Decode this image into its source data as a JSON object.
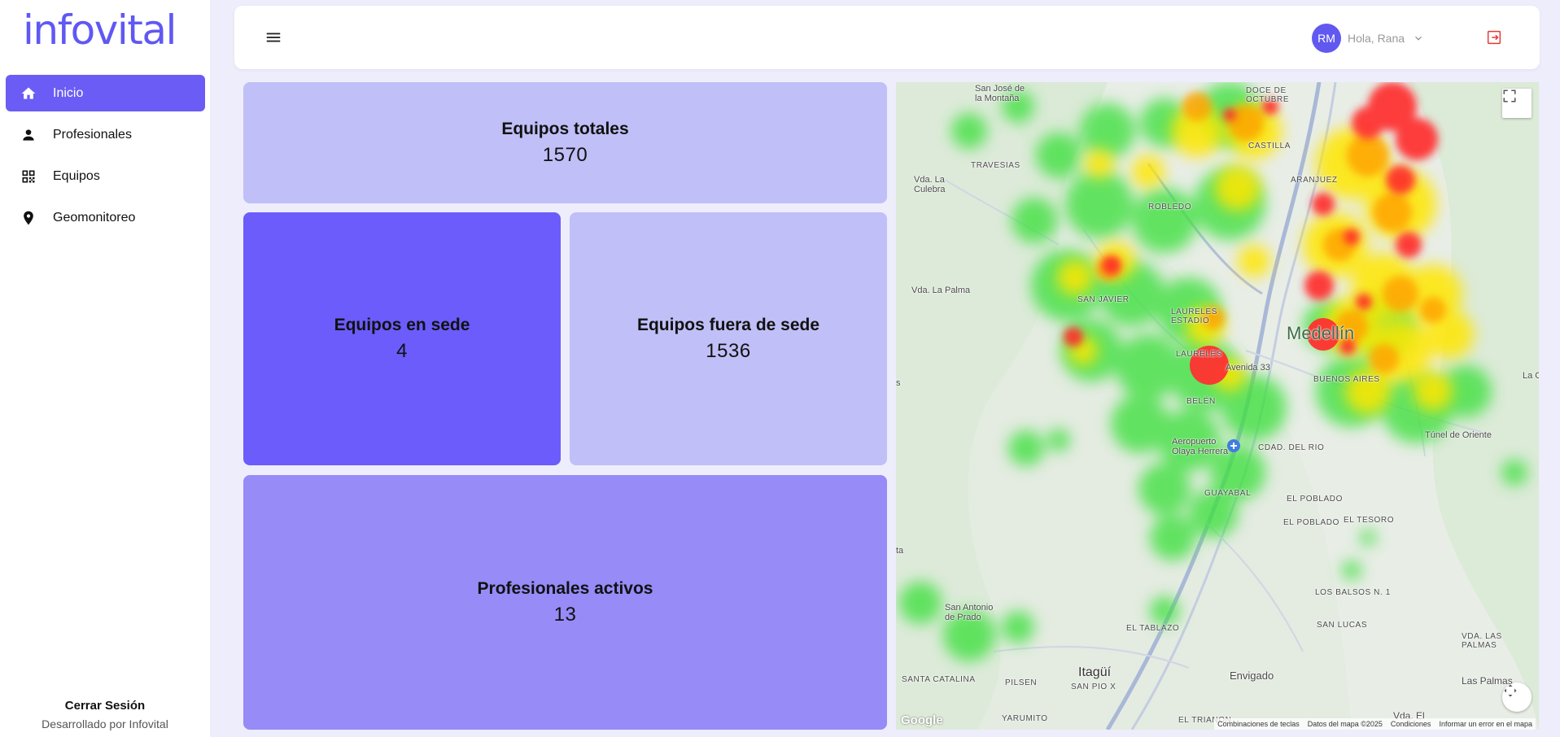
{
  "app": {
    "logo_text": "infovital"
  },
  "sidebar": {
    "items": [
      {
        "label": "Inicio",
        "icon": "home-icon",
        "active": true
      },
      {
        "label": "Profesionales",
        "icon": "person-icon",
        "active": false
      },
      {
        "label": "Equipos",
        "icon": "qr-code-icon",
        "active": false
      },
      {
        "label": "Geomonitoreo",
        "icon": "location-pin-icon",
        "active": false
      }
    ],
    "logout_label": "Cerrar Sesión",
    "developer_text": "Desarrollado por Infovital"
  },
  "header": {
    "avatar_initials": "RM",
    "greeting": "Hola, Rana"
  },
  "stats": {
    "total": {
      "title": "Equipos totales",
      "value": "1570"
    },
    "in_site": {
      "title": "Equipos en sede",
      "value": "4"
    },
    "out_site": {
      "title": "Equipos fuera de sede",
      "value": "1536"
    },
    "professionals": {
      "title": "Profesionales activos",
      "value": "13"
    }
  },
  "map": {
    "labels": {
      "san_jose": "San José de\nla Montaña",
      "doce_octubre": "DOCE DE\nOCTUBRE",
      "castilla": "CASTILLA",
      "travesias": "TRAVESIAS",
      "la_culebra": "Vda. La\nCulebra",
      "aranjuez": "ARANJUEZ",
      "robledo": "ROBLEDO",
      "la_palma": "Vda. La Palma",
      "san_javier": "SAN JAVIER",
      "laureles_estadio": "LAURELES\nESTADIO",
      "medellin": "Medellín",
      "laureles": "LAURELES",
      "avenida33": "Avenida 33",
      "buenos_aires": "BUENOS AIRES",
      "belen": "BELÉN",
      "aeropuerto": "Aeropuerto\nOlaya Herrera",
      "cdad_rio": "CDAD. DEL RIO",
      "tunel": "Túnel de Oriente",
      "guayabal": "GUAYABAL",
      "el_poblado": "EL POBLADO",
      "el_poblado2": "EL POBLADO",
      "el_tesoro": "EL TESORO",
      "san_antonio": "San Antonio\nde Prado",
      "los_balsos": "LOS BALSOS N. 1",
      "el_tablazo": "EL TABLAZO",
      "san_lucas": "SAN LUCAS",
      "vda_palmas": "VDA. LAS\nPALMAS",
      "itagui": "Itagüí",
      "san_pio": "SAN PIO X",
      "envigado": "Envigado",
      "santa_catalina": "SANTA CATALINA",
      "pilsen": "PILSEN",
      "las_palmas": "Las Palmas",
      "yarumito": "YARUMITO",
      "el_trianon": "EL TRIANON",
      "vda_edge": "Vda. El",
      "la_edge": "La C",
      "s_edge": "s",
      "ta_edge": "ta"
    },
    "attribution": {
      "shortcuts": "Combinaciones de teclas",
      "data": "Datos del mapa ©2025",
      "terms": "Condiciones",
      "report": "Informar un error en el mapa"
    },
    "google": "Google",
    "heat_colors": {
      "high": "#ff2a2a",
      "mid": "#ffe600",
      "low": "#3ee03e"
    }
  }
}
